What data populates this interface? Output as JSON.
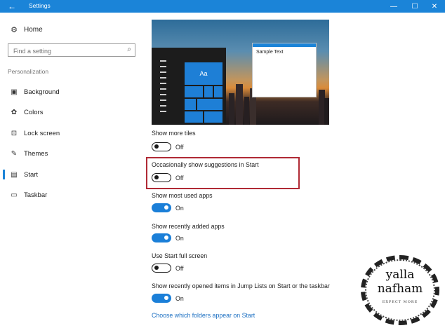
{
  "titlebar": {
    "title": "Settings",
    "back_glyph": "←",
    "minimize_glyph": "—",
    "maximize_glyph": "☐",
    "close_glyph": "✕",
    "color": "#1b84d8"
  },
  "sidebar": {
    "home_label": "Home",
    "search_placeholder": "Find a setting",
    "section_label": "Personalization",
    "items": [
      {
        "label": "Background",
        "icon": "picture-icon"
      },
      {
        "label": "Colors",
        "icon": "palette-icon"
      },
      {
        "label": "Lock screen",
        "icon": "lock-screen-icon"
      },
      {
        "label": "Themes",
        "icon": "themes-icon"
      },
      {
        "label": "Start",
        "icon": "start-icon",
        "active": true
      },
      {
        "label": "Taskbar",
        "icon": "taskbar-icon"
      }
    ]
  },
  "preview": {
    "tile_label": "Aa",
    "sample_text": "Sample Text"
  },
  "settings": [
    {
      "label": "Show more tiles",
      "state": "Off",
      "on": false
    },
    {
      "label": "Occasionally show suggestions in Start",
      "state": "Off",
      "on": false,
      "highlighted": true
    },
    {
      "label": "Show most used apps",
      "state": "On",
      "on": true
    },
    {
      "label": "Show recently added apps",
      "state": "On",
      "on": true
    },
    {
      "label": "Use Start full screen",
      "state": "Off",
      "on": false
    },
    {
      "label": "Show recently opened items in Jump Lists on Start or the taskbar",
      "state": "On",
      "on": true
    }
  ],
  "link_text": "Choose which folders appear on Start",
  "watermark": {
    "line1": "yalla",
    "line2": "nafham",
    "tagline": "EXPECT MORE"
  },
  "colors": {
    "accent": "#1b7fd8",
    "highlight_border": "#b02a35",
    "link": "#1b6fc2"
  }
}
